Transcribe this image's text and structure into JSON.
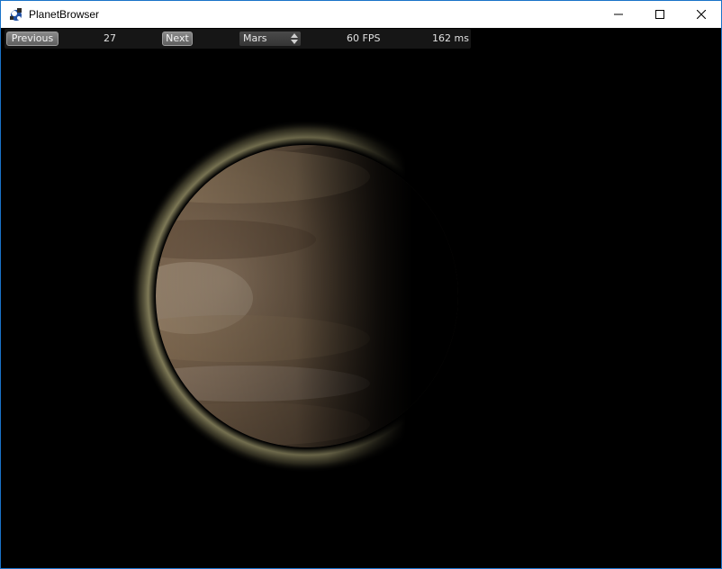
{
  "window": {
    "title": "PlanetBrowser",
    "icon": "planet-browser-app-icon",
    "controls": {
      "minimize_icon": "minimize-icon",
      "maximize_icon": "maximize-icon",
      "close_icon": "close-icon"
    },
    "border_color": "#1a73c8"
  },
  "toolbar": {
    "previous_label": "Previous",
    "index_value": "27",
    "next_label": "Next",
    "planet_select": {
      "selected": "Mars",
      "icon": "updown-arrows-icon"
    },
    "fps_text": "60 FPS",
    "frame_time_text": "162 ms"
  },
  "scene": {
    "background_color": "#000000",
    "planet_colors": {
      "lit": "#a08668",
      "mid": "#6b5844",
      "shadow": "#0d0a07",
      "atmosphere_glow": "#e8dfa0"
    }
  }
}
